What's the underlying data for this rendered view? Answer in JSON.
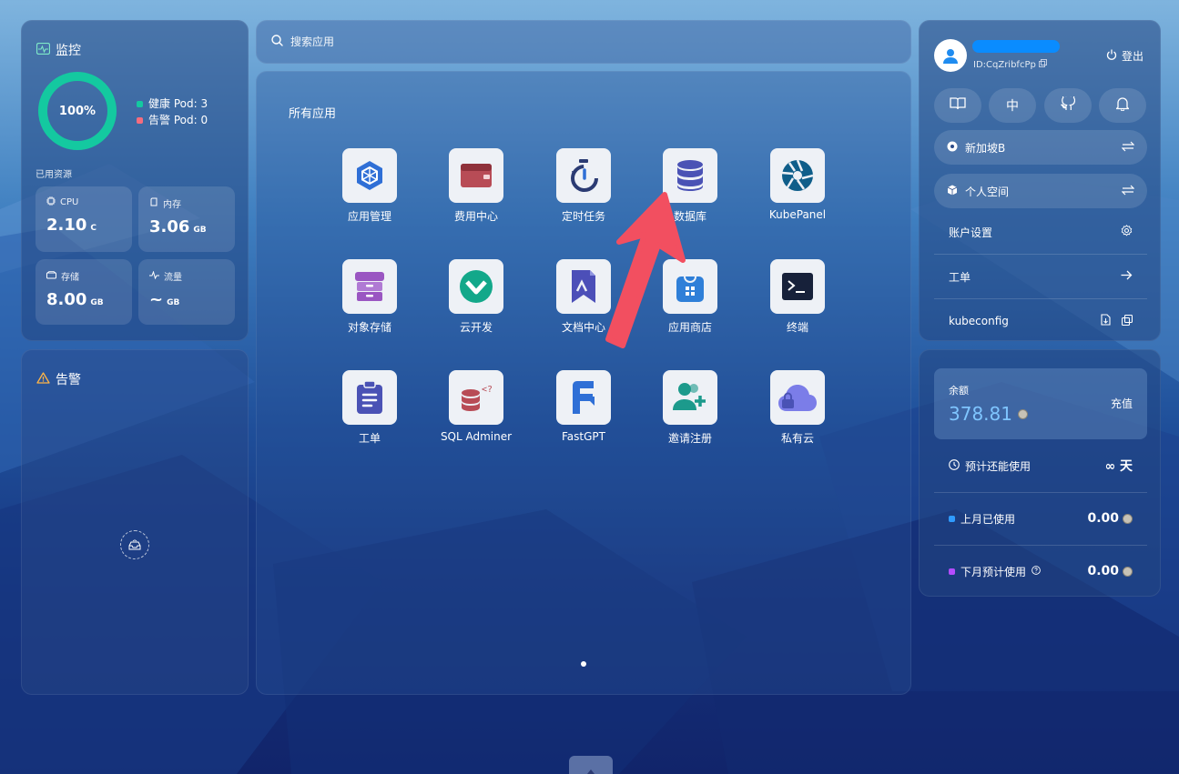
{
  "monitor": {
    "title": "监控",
    "health_percent": 100,
    "health_label": "100%",
    "healthy_pods": "健康 Pod: 3",
    "alert_pods": "告警 Pod: 0",
    "resources_title": "已用资源",
    "cpu": {
      "label": "CPU",
      "value": "2.10",
      "unit": "C"
    },
    "memory": {
      "label": "内存",
      "value": "3.06",
      "unit": "GB"
    },
    "storage": {
      "label": "存储",
      "value": "8.00",
      "unit": "GB"
    },
    "traffic": {
      "label": "流量",
      "value": "~",
      "unit": "GB"
    },
    "colors": {
      "healthy": "#14c9a0",
      "alert": "#f56c7e"
    }
  },
  "alerts": {
    "title": "告警"
  },
  "search": {
    "placeholder": "搜索应用"
  },
  "apps": {
    "title": "所有应用",
    "items": [
      {
        "name": "应用管理",
        "icon": "hexagon-icon"
      },
      {
        "name": "费用中心",
        "icon": "wallet-icon"
      },
      {
        "name": "定时任务",
        "icon": "timer-icon"
      },
      {
        "name": "数据库",
        "icon": "database-icon"
      },
      {
        "name": "KubePanel",
        "icon": "aperture-icon"
      },
      {
        "name": "对象存储",
        "icon": "cabinet-icon"
      },
      {
        "name": "云开发",
        "icon": "cloud-dev-icon"
      },
      {
        "name": "文档中心",
        "icon": "bookmark-icon"
      },
      {
        "name": "应用商店",
        "icon": "store-bag-icon"
      },
      {
        "name": "终端",
        "icon": "terminal-icon"
      },
      {
        "name": "工单",
        "icon": "clipboard-icon"
      },
      {
        "name": "SQL Adminer",
        "icon": "sql-db-icon"
      },
      {
        "name": "FastGPT",
        "icon": "fastgpt-icon"
      },
      {
        "name": "邀请注册",
        "icon": "user-add-icon"
      },
      {
        "name": "私有云",
        "icon": "cloud-lock-icon"
      }
    ]
  },
  "user": {
    "name": "",
    "id": "ID:CqZribfcPp",
    "logout": "登出",
    "lang": "中",
    "region": "新加坡B",
    "workspace": "个人空间",
    "menu": {
      "account": "账户设置",
      "ticket": "工单",
      "kubeconfig": "kubeconfig"
    }
  },
  "balance": {
    "label": "余额",
    "amount": "378.81",
    "recharge": "充值",
    "remaining_label": "预计还能使用",
    "remaining_value": "∞ 天",
    "last_month_label": "上月已使用",
    "last_month_value": "0.00",
    "next_month_label": "下月预计使用",
    "next_month_value": "0.00",
    "colors": {
      "amount": "#7fc5ff",
      "last_month": "#2f9bff",
      "next_month": "#b44cff"
    }
  }
}
